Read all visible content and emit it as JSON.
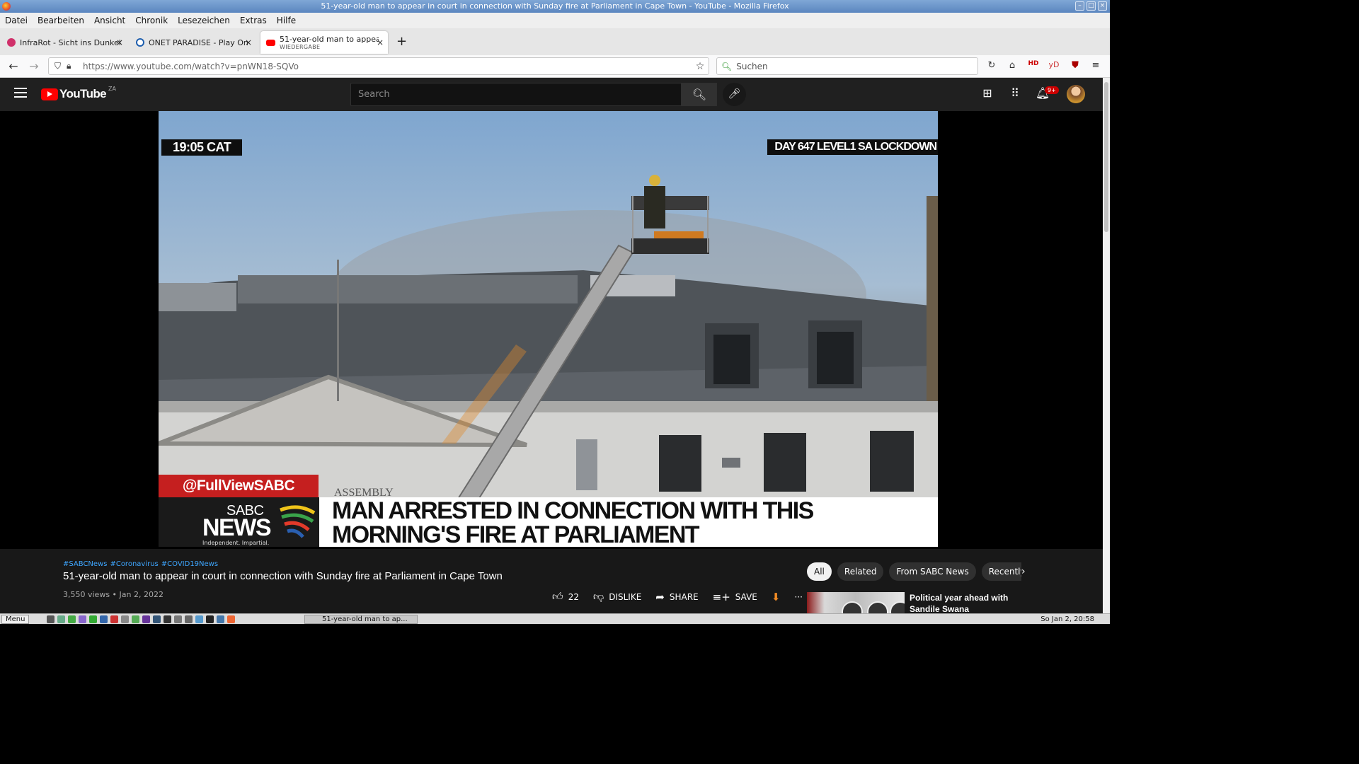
{
  "window": {
    "title": "51-year-old man to appear in court in connection with Sunday fire at Parliament in Cape Town - YouTube - Mozilla Firefox",
    "buttons": [
      "–",
      "□",
      "×"
    ]
  },
  "menubar": [
    "Datei",
    "Bearbeiten",
    "Ansicht",
    "Chronik",
    "Lesezeichen",
    "Extras",
    "Hilfe"
  ],
  "tabs": [
    {
      "label": "InfraRot - Sicht ins Dunkel",
      "close": "×"
    },
    {
      "label": "ONET PARADISE - Play One",
      "close": "×"
    },
    {
      "label": "51-year-old man to appea",
      "sublabel": "WIEDERGABE",
      "close": "×"
    }
  ],
  "new_tab": "+",
  "navbar": {
    "url": "https://www.youtube.com/watch?v=pnWN18-SQVo",
    "search_placeholder": "Suchen",
    "star": "☆"
  },
  "youtube": {
    "logo_text": "YouTube",
    "country": "ZA",
    "search_placeholder": "Search",
    "notifications_badge": "9+"
  },
  "video_overlay": {
    "time": "19:05 CAT",
    "day_banner": "DAY 647 LEVEL1 SA LOCKDOWN",
    "handle": "@FullViewSABC",
    "brand_top": "SABC",
    "brand_bottom": "NEWS",
    "brand_tag": "Independent. Impartial.",
    "headline_line1": "MAN ARRESTED IN CONNECTION WITH THIS",
    "headline_line2": "MORNING'S FIRE AT PARLIAMENT",
    "building_text": "ASSEMBLY"
  },
  "video": {
    "hashtags": [
      "#SABCNews",
      "#Coronavirus",
      "#COVID19News"
    ],
    "title": "51-year-old man to appear in court in connection with Sunday fire at Parliament in Cape Town",
    "meta": "3,550 views • Jan 2, 2022",
    "likes": "22",
    "dislike_label": "DISLIKE",
    "share_label": "SHARE",
    "save_label": "SAVE",
    "more": "···"
  },
  "chips": [
    "All",
    "Related",
    "From SABC News",
    "Recently"
  ],
  "related": {
    "title_line1": "Political year ahead with",
    "title_line2": "Sandile Swana"
  },
  "taskbar": {
    "menu_label": "Menu",
    "task_label": "51-year-old man to ap...",
    "clock": "So Jan  2, 20:58"
  },
  "colors": {
    "yt_red": "#ff0000",
    "yt_bg": "#202020",
    "link_blue": "#3ea6ff",
    "sabc_red": "#c51f1f"
  }
}
